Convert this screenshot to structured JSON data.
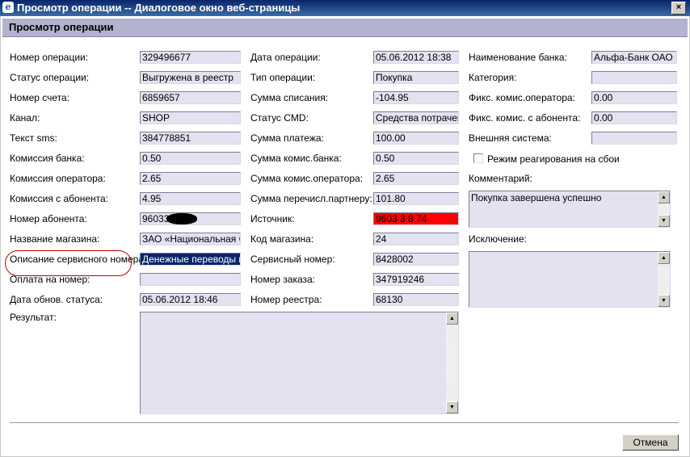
{
  "window": {
    "title": "Просмотр операции -- Диалоговое окно веб-страницы",
    "app_icon": "e",
    "close_glyph": "×"
  },
  "header": {
    "title": "Просмотр операции"
  },
  "col1": {
    "op_number": {
      "label": "Номер операции:",
      "value": "329496677"
    },
    "op_status": {
      "label": "Статус операции:",
      "value": "Выгружена в реестр"
    },
    "account": {
      "label": "Номер счета:",
      "value": "6859657"
    },
    "channel": {
      "label": "Канал:",
      "value": "SHOP"
    },
    "sms": {
      "label": "Текст sms:",
      "value": "384778851"
    },
    "bank_fee": {
      "label": "Комиссия банка:",
      "value": "0.50"
    },
    "operator_fee": {
      "label": "Комиссия оператора:",
      "value": "2.65"
    },
    "subscriber_fee": {
      "label": "Комиссия с абонента:",
      "value": "4.95"
    },
    "subscriber_number": {
      "label": "Номер абонента:",
      "value": "96033"
    },
    "shop_name": {
      "label": "Название магазина:",
      "value": "ЗАО «Национальная Сер"
    },
    "service_desc": {
      "label": "Описание сервисного номера:",
      "value": "Денежные переводы на"
    },
    "pay_to": {
      "label": "Оплата на номер:",
      "value": ""
    },
    "status_date": {
      "label": "Дата обнов. статуса:",
      "value": "05.06.2012 18:46"
    },
    "result": {
      "label": "Результат:",
      "value": ""
    }
  },
  "col2": {
    "op_date": {
      "label": "Дата операции:",
      "value": "05.06.2012 18:38"
    },
    "op_type": {
      "label": "Тип операции:",
      "value": "Покупка"
    },
    "debit_sum": {
      "label": "Сумма списания:",
      "value": "-104.95"
    },
    "cmd_status": {
      "label": "Статус CMD:",
      "value": "Средства потрачены"
    },
    "payment_sum": {
      "label": "Сумма платежа:",
      "value": "100.00"
    },
    "bank_fee_sum": {
      "label": "Сумма комис.банка:",
      "value": "0.50"
    },
    "operator_fee_sum": {
      "label": "Сумма комис.оператора:",
      "value": "2.65"
    },
    "partner_sum": {
      "label": "Сумма перечисл.партнеру:",
      "value": "101.80"
    },
    "source": {
      "label": "Источник:",
      "value": "9603 3 8 74"
    },
    "shop_code": {
      "label": "Код магазина:",
      "value": "24"
    },
    "service_number": {
      "label": "Сервисный номер:",
      "value": "8428002"
    },
    "order_number": {
      "label": "Номер заказа:",
      "value": "347919246"
    },
    "registry_number": {
      "label": "Номер реестра:",
      "value": "68130"
    }
  },
  "col3": {
    "bank_name": {
      "label": "Наименование банка:",
      "value": "Альфа-Банк ОАО"
    },
    "category": {
      "label": "Категория:",
      "value": ""
    },
    "operator_fixed_fee": {
      "label": "Фикс. комис.оператора:",
      "value": "0.00"
    },
    "subscriber_fixed_fee": {
      "label": "Фикс. комис. с абонента:",
      "value": "0.00"
    },
    "external_system": {
      "label": "Внешняя система:",
      "value": ""
    },
    "failure_mode": {
      "label": "Режим реагирования на сбои",
      "checked": false
    },
    "comment": {
      "label": "Комментарий:",
      "value": "Покупка завершена успешно"
    },
    "exception": {
      "label": "Исключение:",
      "value": ""
    }
  },
  "scroll": {
    "up": "▲",
    "down": "▼"
  },
  "footer": {
    "cancel_label": "Отмена"
  }
}
